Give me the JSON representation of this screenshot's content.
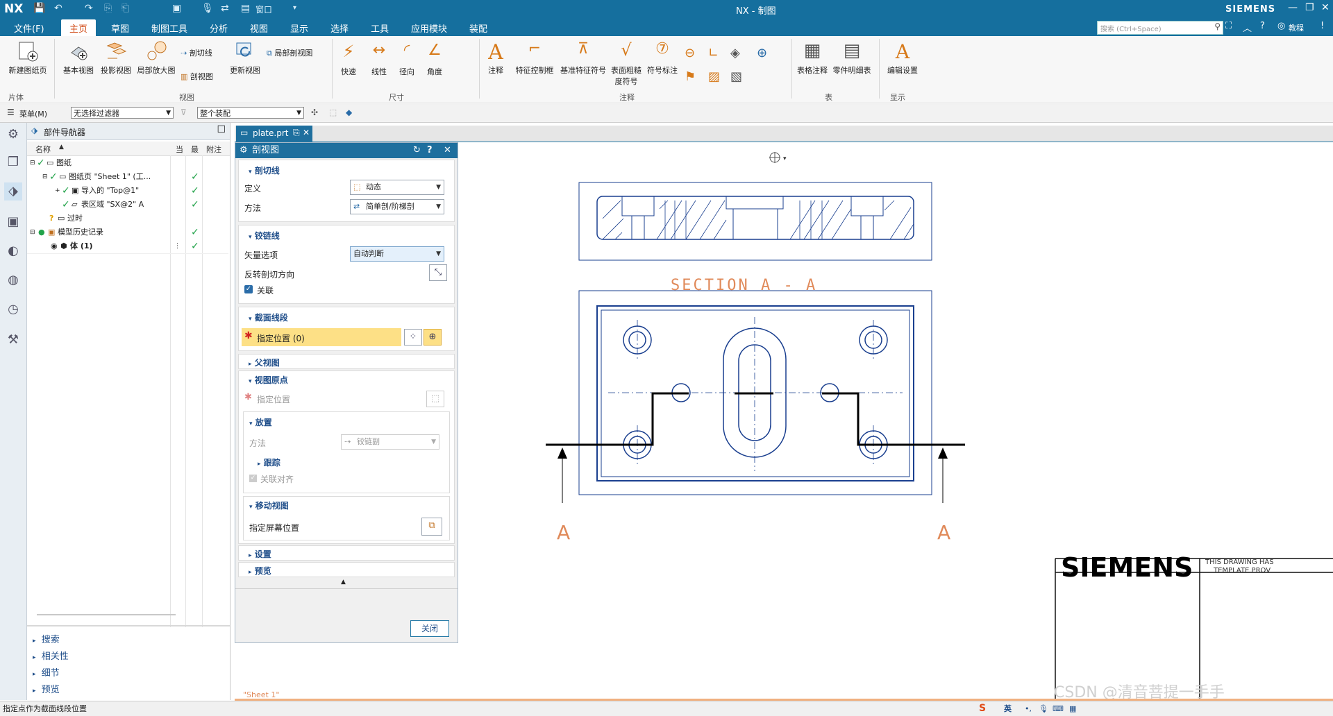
{
  "app": {
    "logo": "NX",
    "window_title": "NX - 制图",
    "brand": "SIEMENS",
    "tutorial_label": "教程"
  },
  "quick_access": {
    "window_label": "窗口"
  },
  "menu": {
    "file": "文件(F)",
    "tabs": [
      "主页",
      "草图",
      "制图工具",
      "分析",
      "视图",
      "显示",
      "选择",
      "工具",
      "应用模块",
      "装配"
    ],
    "active_tab": "主页",
    "search_placeholder": "搜索 (Ctrl+Space)"
  },
  "ribbon": {
    "groups": {
      "sheet": "片体",
      "view": "视图",
      "dimension": "尺寸",
      "annotation": "注释",
      "table": "表",
      "display": "显示"
    },
    "buttons": {
      "new_sheet": "新建图纸页",
      "base_view": "基本视图",
      "projected_view": "投影视图",
      "detail_view": "局部放大图",
      "section_line": "剖切线",
      "section_view": "剖视图",
      "update_view": "更新视图",
      "break_out_section": "局部剖视图",
      "rapid": "快速",
      "linear": "线性",
      "radial": "径向",
      "angular": "角度",
      "note": "注释",
      "feature_control_frame": "特征控制框",
      "datum_feature_symbol": "基准特征符号",
      "surface_finish_line1": "表面粗糙",
      "surface_finish_line2": "度符号",
      "symbol_callout": "符号标注",
      "tabular_note": "表格注释",
      "parts_list": "零件明细表",
      "edit_settings": "编辑设置"
    }
  },
  "selection_bar": {
    "menu_label": "菜单(M)",
    "filter": "无选择过滤器",
    "scope": "整个装配"
  },
  "navigator": {
    "title": "部件导航器",
    "columns": [
      "名称",
      "当",
      "最",
      "附注"
    ],
    "rows": [
      {
        "label": "图纸",
        "checked": true
      },
      {
        "label": "图纸页 \"Sheet 1\" (工...",
        "checked": true
      },
      {
        "label": "导入的 \"Top@1\"",
        "checked": true
      },
      {
        "label": "表区域 \"SX@2\" A",
        "checked": true
      },
      {
        "label": "过时",
        "checked": false
      },
      {
        "label": "模型历史记录",
        "checked": true
      },
      {
        "label": "体 (1)",
        "checked": true
      }
    ],
    "panels": [
      "搜索",
      "相关性",
      "细节",
      "预览"
    ]
  },
  "drawing_tab": {
    "file": "plate.prt"
  },
  "dialog": {
    "title": "剖视图",
    "section_line": {
      "header": "剖切线",
      "definition_label": "定义",
      "definition_value": "动态",
      "method_label": "方法",
      "method_value": "简单剖/阶梯剖"
    },
    "hinge_line": {
      "header": "铰链线",
      "vector_label": "矢量选项",
      "vector_value": "自动判断",
      "reverse_label": "反转剖切方向",
      "associative_label": "关联"
    },
    "section_segment": {
      "header": "截面线段",
      "specify_location": "指定位置 (0)"
    },
    "parent_view": {
      "header": "父视图"
    },
    "view_origin": {
      "header": "视图原点",
      "specify_location": "指定位置",
      "placement_header": "放置",
      "method_label": "方法",
      "method_value": "铰链副",
      "tracking_label": "跟踪",
      "associative_align": "关联对齐",
      "move_view_header": "移动视图",
      "screen_position": "指定屏幕位置"
    },
    "settings": {
      "header": "设置"
    },
    "preview": {
      "header": "预览"
    },
    "close_button": "关闭"
  },
  "drawing": {
    "section_title": "SECTION  A - A",
    "label_left": "A",
    "label_right": "A",
    "sheet_name": "\"Sheet 1\"",
    "title_block_brand": "SIEMENS",
    "title_block_text1": "THIS DRAWING HAS",
    "title_block_text2": "TEMPLATE PROV",
    "watermark": "CSDN @清音菩提一手手"
  },
  "status_bar": {
    "prompt": "指定点作为截面线段位置",
    "ime_label": "英"
  },
  "colors": {
    "title_bar": "#156f9e",
    "accent": "#d04a15",
    "drawing_blue": "#1a3f8f",
    "check_green": "#22a34a",
    "highlight": "#fde086"
  }
}
